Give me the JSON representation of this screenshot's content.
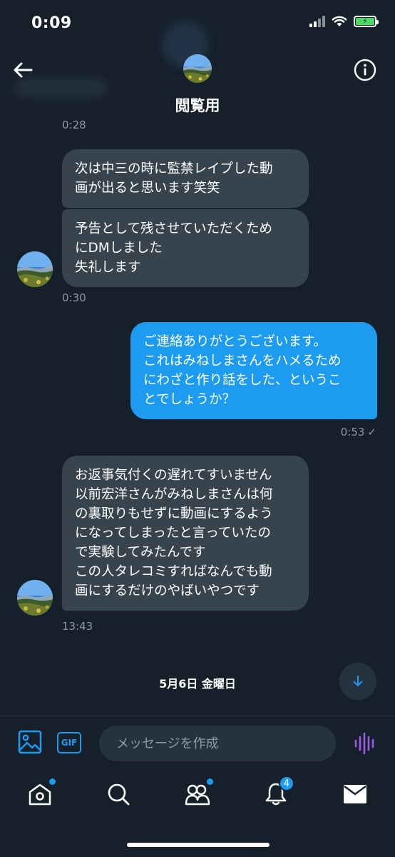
{
  "status": {
    "time": "0:09"
  },
  "header": {
    "title": "閲覧用"
  },
  "messages": {
    "top_timestamp": "0:28",
    "m1": "次は中三の時に監禁レイプした動\n画が出ると思います笑笑",
    "m2": "予告として残させていただくため\nにDMしました\n失礼します",
    "m2_time": "0:30",
    "m3": "ご連絡ありがとうございます。\nこれはみねしまさんをハメるため\nにわざと作り話をした、というこ\nとでしょうか？",
    "m3_time": "0:53",
    "m3_receipt": "✓",
    "m4": "お返事気付くの遅れてすいません\n以前宏洋さんがみねしまさんは何\nの裏取りもせずに動画にするよう\nになってしまったと言っていたの\nで実験してみたんです\nこの人タレコミすればなんでも動\n画にするだけのやばいやつです",
    "m4_time": "13:43"
  },
  "date_separator": "5月6日 金曜日",
  "composer": {
    "gif_label": "GIF",
    "placeholder": "メッセージを作成"
  },
  "tabbar": {
    "notifications_badge": "4"
  },
  "colors": {
    "background": "#15202b",
    "incoming_bubble": "#38444d",
    "outgoing_bubble": "#1d9bf0",
    "accent": "#1d9bf0",
    "voice_accent": "#9b5de5"
  },
  "icons": {
    "back": "arrow-left-icon",
    "info": "info-icon",
    "scroll": "arrow-down-icon",
    "media": "image-icon",
    "voice": "voice-wave-icon",
    "home": "home-icon",
    "search": "search-icon",
    "communities": "communities-icon",
    "notifications": "bell-icon",
    "messages": "mail-icon"
  }
}
